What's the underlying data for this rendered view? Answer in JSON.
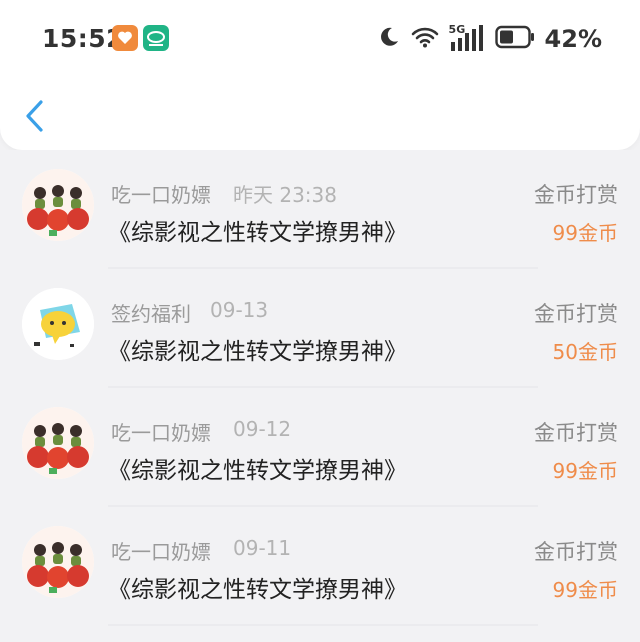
{
  "status_bar": {
    "time": "15:52",
    "network": "5G",
    "battery": "42%",
    "icons": [
      "app-orange-icon",
      "app-green-icon",
      "moon-icon",
      "wifi-icon",
      "signal-icon",
      "battery-icon"
    ]
  },
  "nav": {
    "back_icon": "chevron-left-icon"
  },
  "colors": {
    "accent_blue": "#3aa0e8",
    "amount_orange": "#ef8c4a"
  },
  "records": [
    {
      "name": "吃一口奶嫖",
      "date": "昨天 23:38",
      "title": "《综影视之性转文学撩男神》",
      "reward_type": "金币打赏",
      "amount": "99金币",
      "avatar": "apple-avatar"
    },
    {
      "name": "签约福利",
      "date": "09-13",
      "title": "《综影视之性转文学撩男神》",
      "reward_type": "金币打赏",
      "amount": "50金币",
      "avatar": "gift-avatar"
    },
    {
      "name": "吃一口奶嫖",
      "date": "09-12",
      "title": "《综影视之性转文学撩男神》",
      "reward_type": "金币打赏",
      "amount": "99金币",
      "avatar": "apple-avatar"
    },
    {
      "name": "吃一口奶嫖",
      "date": "09-11",
      "title": "《综影视之性转文学撩男神》",
      "reward_type": "金币打赏",
      "amount": "99金币",
      "avatar": "apple-avatar"
    }
  ]
}
